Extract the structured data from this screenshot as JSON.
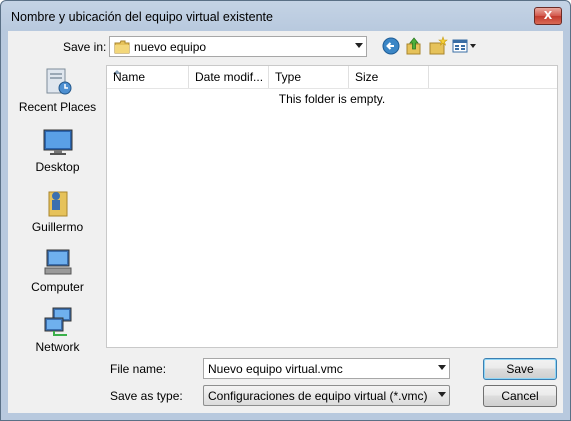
{
  "window": {
    "title": "Nombre y ubicación del equipo virtual existente",
    "close_glyph": "X"
  },
  "toolbar": {
    "save_in_label": "Save in:",
    "save_in_value": "nuevo equipo",
    "back_icon": "back-arrow-icon",
    "up_icon": "up-folder-icon",
    "new_folder_icon": "new-folder-icon",
    "views_icon": "views-menu-icon"
  },
  "places": [
    {
      "label": "Recent Places",
      "icon": "recent-places-icon"
    },
    {
      "label": "Desktop",
      "icon": "desktop-icon"
    },
    {
      "label": "Guillermo",
      "icon": "user-folder-icon"
    },
    {
      "label": "Computer",
      "icon": "computer-icon"
    },
    {
      "label": "Network",
      "icon": "network-icon"
    }
  ],
  "filelist": {
    "columns": [
      "Name",
      "Date modif...",
      "Type",
      "Size"
    ],
    "sorted_column": "Name",
    "empty_message": "This folder is empty."
  },
  "form": {
    "file_name_label": "File name:",
    "file_name_value": "Nuevo equipo virtual.vmc",
    "save_as_type_label": "Save as type:",
    "save_as_type_value": "Configuraciones de equipo virtual (*.vmc)",
    "save_button": "Save",
    "cancel_button": "Cancel"
  },
  "colors": {
    "title_bar": "#c4d3e5",
    "close_button": "#c23a2d",
    "default_button_border": "#3c7fb1"
  }
}
